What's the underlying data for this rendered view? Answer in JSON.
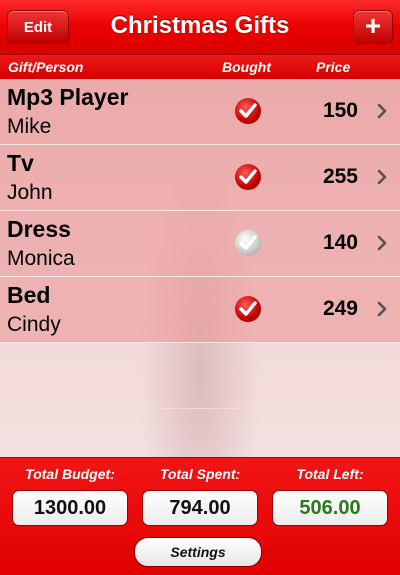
{
  "nav": {
    "edit_label": "Edit",
    "title": "Christmas Gifts",
    "add_label": "+"
  },
  "columns": {
    "gift_person": "Gift/Person",
    "bought": "Bought",
    "price": "Price"
  },
  "items": [
    {
      "gift": "Mp3 Player",
      "person": "Mike",
      "bought": true,
      "price": "150"
    },
    {
      "gift": "Tv",
      "person": "John",
      "bought": true,
      "price": "255"
    },
    {
      "gift": "Dress",
      "person": "Monica",
      "bought": false,
      "price": "140"
    },
    {
      "gift": "Bed",
      "person": "Cindy",
      "bought": true,
      "price": "249"
    }
  ],
  "totals": {
    "budget_label": "Total Budget:",
    "budget_value": "1300.00",
    "spent_label": "Total Spent:",
    "spent_value": "794.00",
    "left_label": "Total Left:",
    "left_value": "506.00"
  },
  "settings_label": "Settings",
  "colors": {
    "accent_red": "#e00000",
    "left_value_green": "#2a7a1a"
  },
  "icons": {
    "bought": "checkmark-icon",
    "disclosure": "chevron-right-icon"
  }
}
